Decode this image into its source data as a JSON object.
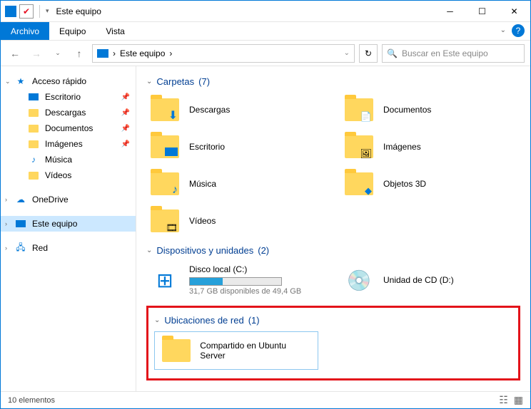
{
  "title": "Este equipo",
  "ribbon": {
    "file": "Archivo",
    "equipo": "Equipo",
    "vista": "Vista"
  },
  "address": {
    "path": "Este equipo",
    "sep": "›"
  },
  "search": {
    "placeholder": "Buscar en Este equipo"
  },
  "sidebar": {
    "quick": "Acceso rápido",
    "desktop": "Escritorio",
    "downloads": "Descargas",
    "documents": "Documentos",
    "images": "Imágenes",
    "music": "Música",
    "videos": "Vídeos",
    "onedrive": "OneDrive",
    "thispc": "Este equipo",
    "network": "Red"
  },
  "sections": {
    "folders": {
      "title": "Carpetas",
      "count": "(7)",
      "items": {
        "downloads": "Descargas",
        "documents": "Documentos",
        "desktop": "Escritorio",
        "images": "Imágenes",
        "music": "Música",
        "objects3d": "Objetos 3D",
        "videos": "Vídeos"
      }
    },
    "devices": {
      "title": "Dispositivos y unidades",
      "count": "(2)",
      "localdisk": {
        "name": "Disco local (C:)",
        "sub": "31,7 GB disponibles de 49,4 GB"
      },
      "cd": {
        "name": "Unidad de CD (D:)"
      }
    },
    "network": {
      "title": "Ubicaciones de red",
      "count": "(1)",
      "share": "Compartido en Ubuntu Server"
    }
  },
  "status": {
    "count": "10 elementos"
  }
}
